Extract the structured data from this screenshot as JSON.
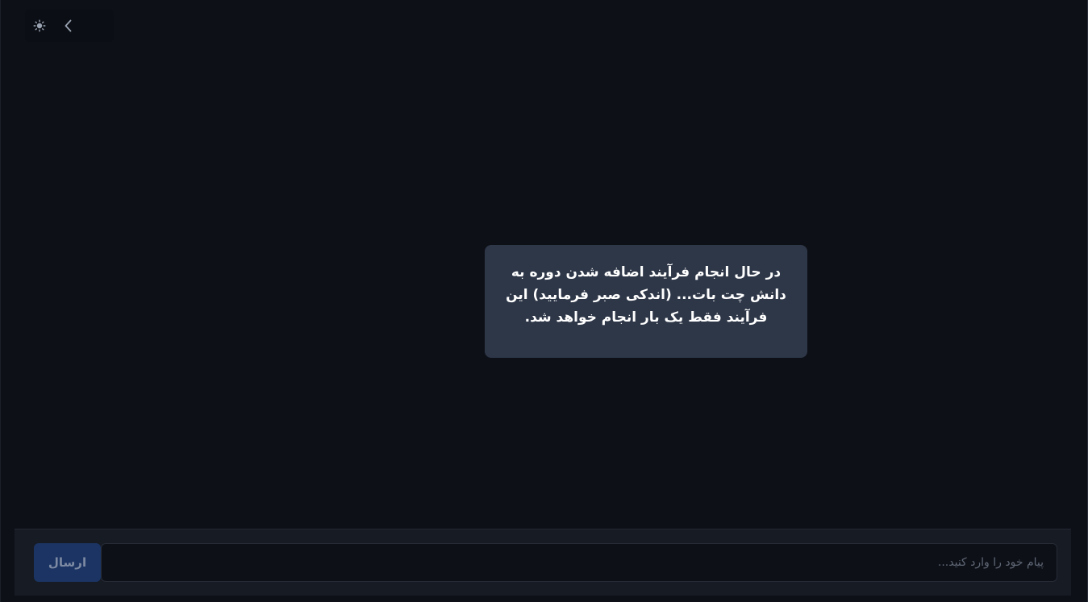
{
  "header": {
    "theme_icon": "sun-icon",
    "collapse_icon": "chevron-left-icon"
  },
  "chat": {
    "message": "در حال انجام فرآیند اضافه شدن دوره به دانش چت بات... (اندکی صبر فرمایید) این فرآیند فقط یک بار انجام خواهد شد."
  },
  "composer": {
    "input_value": "",
    "input_placeholder": "پیام خود را وارد کنید...",
    "send_label": "ارسال"
  },
  "colors": {
    "background": "#0d1017",
    "bubble": "#2e3748",
    "send_button": "#1b3463",
    "composer_bar": "#171b24"
  }
}
